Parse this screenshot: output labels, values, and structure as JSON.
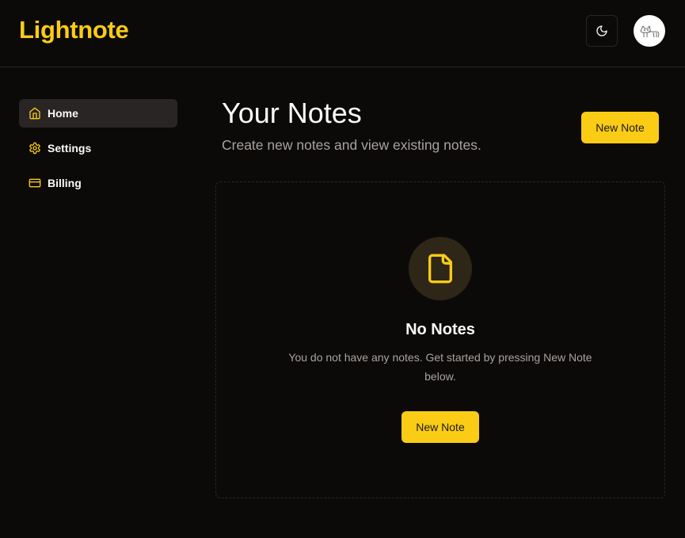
{
  "header": {
    "logo": "Lightnote",
    "theme_toggle_icon": "moon-icon",
    "avatar_icon": "cat-sketch-avatar"
  },
  "sidebar": {
    "items": [
      {
        "label": "Home",
        "icon": "home-icon",
        "active": true
      },
      {
        "label": "Settings",
        "icon": "gear-icon",
        "active": false
      },
      {
        "label": "Billing",
        "icon": "credit-card-icon",
        "active": false
      }
    ]
  },
  "main": {
    "title": "Your Notes",
    "subtitle": "Create new notes and view existing notes.",
    "new_note_label": "New Note",
    "empty_state": {
      "icon": "file-icon",
      "title": "No Notes",
      "description": "You do not have any notes. Get started by pressing New Note below.",
      "button_label": "New Note"
    }
  },
  "colors": {
    "accent": "#facc15",
    "background": "#0c0a09",
    "muted_text": "#a8a29e",
    "border": "#292524"
  }
}
